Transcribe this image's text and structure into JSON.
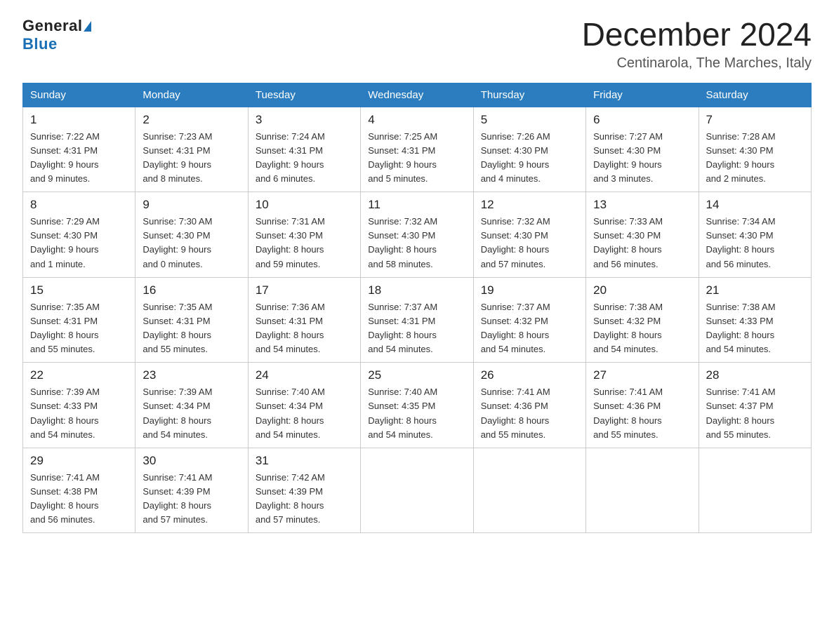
{
  "logo": {
    "general": "General",
    "blue": "Blue",
    "triangle": "▲"
  },
  "title": "December 2024",
  "subtitle": "Centinarola, The Marches, Italy",
  "weekdays": [
    "Sunday",
    "Monday",
    "Tuesday",
    "Wednesday",
    "Thursday",
    "Friday",
    "Saturday"
  ],
  "weeks": [
    [
      {
        "day": "1",
        "sunrise": "7:22 AM",
        "sunset": "4:31 PM",
        "daylight": "9 hours and 9 minutes."
      },
      {
        "day": "2",
        "sunrise": "7:23 AM",
        "sunset": "4:31 PM",
        "daylight": "9 hours and 8 minutes."
      },
      {
        "day": "3",
        "sunrise": "7:24 AM",
        "sunset": "4:31 PM",
        "daylight": "9 hours and 6 minutes."
      },
      {
        "day": "4",
        "sunrise": "7:25 AM",
        "sunset": "4:31 PM",
        "daylight": "9 hours and 5 minutes."
      },
      {
        "day": "5",
        "sunrise": "7:26 AM",
        "sunset": "4:30 PM",
        "daylight": "9 hours and 4 minutes."
      },
      {
        "day": "6",
        "sunrise": "7:27 AM",
        "sunset": "4:30 PM",
        "daylight": "9 hours and 3 minutes."
      },
      {
        "day": "7",
        "sunrise": "7:28 AM",
        "sunset": "4:30 PM",
        "daylight": "9 hours and 2 minutes."
      }
    ],
    [
      {
        "day": "8",
        "sunrise": "7:29 AM",
        "sunset": "4:30 PM",
        "daylight": "9 hours and 1 minute."
      },
      {
        "day": "9",
        "sunrise": "7:30 AM",
        "sunset": "4:30 PM",
        "daylight": "9 hours and 0 minutes."
      },
      {
        "day": "10",
        "sunrise": "7:31 AM",
        "sunset": "4:30 PM",
        "daylight": "8 hours and 59 minutes."
      },
      {
        "day": "11",
        "sunrise": "7:32 AM",
        "sunset": "4:30 PM",
        "daylight": "8 hours and 58 minutes."
      },
      {
        "day": "12",
        "sunrise": "7:32 AM",
        "sunset": "4:30 PM",
        "daylight": "8 hours and 57 minutes."
      },
      {
        "day": "13",
        "sunrise": "7:33 AM",
        "sunset": "4:30 PM",
        "daylight": "8 hours and 56 minutes."
      },
      {
        "day": "14",
        "sunrise": "7:34 AM",
        "sunset": "4:30 PM",
        "daylight": "8 hours and 56 minutes."
      }
    ],
    [
      {
        "day": "15",
        "sunrise": "7:35 AM",
        "sunset": "4:31 PM",
        "daylight": "8 hours and 55 minutes."
      },
      {
        "day": "16",
        "sunrise": "7:35 AM",
        "sunset": "4:31 PM",
        "daylight": "8 hours and 55 minutes."
      },
      {
        "day": "17",
        "sunrise": "7:36 AM",
        "sunset": "4:31 PM",
        "daylight": "8 hours and 54 minutes."
      },
      {
        "day": "18",
        "sunrise": "7:37 AM",
        "sunset": "4:31 PM",
        "daylight": "8 hours and 54 minutes."
      },
      {
        "day": "19",
        "sunrise": "7:37 AM",
        "sunset": "4:32 PM",
        "daylight": "8 hours and 54 minutes."
      },
      {
        "day": "20",
        "sunrise": "7:38 AM",
        "sunset": "4:32 PM",
        "daylight": "8 hours and 54 minutes."
      },
      {
        "day": "21",
        "sunrise": "7:38 AM",
        "sunset": "4:33 PM",
        "daylight": "8 hours and 54 minutes."
      }
    ],
    [
      {
        "day": "22",
        "sunrise": "7:39 AM",
        "sunset": "4:33 PM",
        "daylight": "8 hours and 54 minutes."
      },
      {
        "day": "23",
        "sunrise": "7:39 AM",
        "sunset": "4:34 PM",
        "daylight": "8 hours and 54 minutes."
      },
      {
        "day": "24",
        "sunrise": "7:40 AM",
        "sunset": "4:34 PM",
        "daylight": "8 hours and 54 minutes."
      },
      {
        "day": "25",
        "sunrise": "7:40 AM",
        "sunset": "4:35 PM",
        "daylight": "8 hours and 54 minutes."
      },
      {
        "day": "26",
        "sunrise": "7:41 AM",
        "sunset": "4:36 PM",
        "daylight": "8 hours and 55 minutes."
      },
      {
        "day": "27",
        "sunrise": "7:41 AM",
        "sunset": "4:36 PM",
        "daylight": "8 hours and 55 minutes."
      },
      {
        "day": "28",
        "sunrise": "7:41 AM",
        "sunset": "4:37 PM",
        "daylight": "8 hours and 55 minutes."
      }
    ],
    [
      {
        "day": "29",
        "sunrise": "7:41 AM",
        "sunset": "4:38 PM",
        "daylight": "8 hours and 56 minutes."
      },
      {
        "day": "30",
        "sunrise": "7:41 AM",
        "sunset": "4:39 PM",
        "daylight": "8 hours and 57 minutes."
      },
      {
        "day": "31",
        "sunrise": "7:42 AM",
        "sunset": "4:39 PM",
        "daylight": "8 hours and 57 minutes."
      },
      null,
      null,
      null,
      null
    ]
  ],
  "labels": {
    "sunrise": "Sunrise:",
    "sunset": "Sunset:",
    "daylight": "Daylight:"
  }
}
